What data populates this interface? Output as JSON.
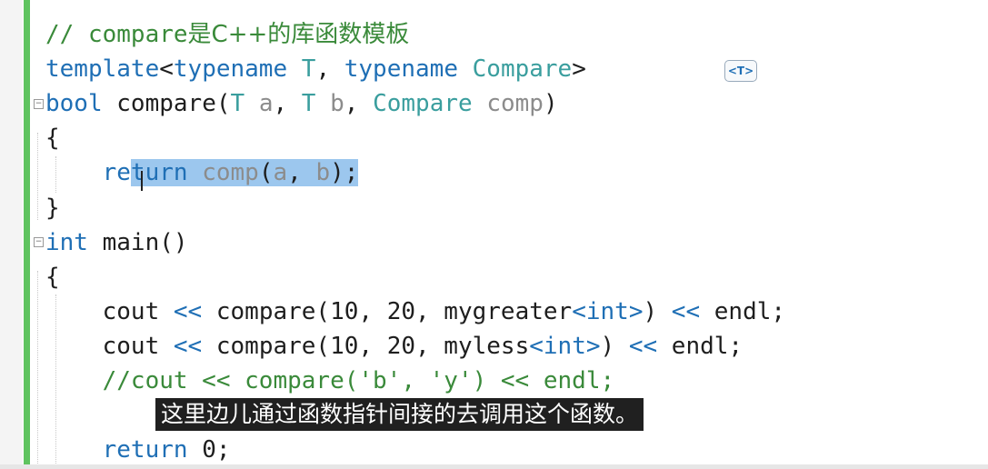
{
  "editor": {
    "lines": [
      {
        "tokens": [
          {
            "t": "// compare",
            "c": "cmt"
          },
          {
            "t": "是C++的库函数模板",
            "c": "cmt-cjk"
          }
        ]
      },
      {
        "tokens": [
          {
            "t": "template",
            "c": "kw"
          },
          {
            "t": "<",
            "c": ""
          },
          {
            "t": "typename",
            "c": "kw"
          },
          {
            "t": " ",
            "c": ""
          },
          {
            "t": "T",
            "c": "type"
          },
          {
            "t": ", ",
            "c": ""
          },
          {
            "t": "typename",
            "c": "kw"
          },
          {
            "t": " ",
            "c": ""
          },
          {
            "t": "Compare",
            "c": "type"
          },
          {
            "t": ">",
            "c": ""
          }
        ]
      },
      {
        "tokens": [
          {
            "t": "bool",
            "c": "kw"
          },
          {
            "t": " compare(",
            "c": ""
          },
          {
            "t": "T",
            "c": "type"
          },
          {
            "t": " ",
            "c": ""
          },
          {
            "t": "a",
            "c": "param"
          },
          {
            "t": ", ",
            "c": ""
          },
          {
            "t": "T",
            "c": "type"
          },
          {
            "t": " ",
            "c": ""
          },
          {
            "t": "b",
            "c": "param"
          },
          {
            "t": ", ",
            "c": ""
          },
          {
            "t": "Compare",
            "c": "type"
          },
          {
            "t": " ",
            "c": ""
          },
          {
            "t": "comp",
            "c": "param"
          },
          {
            "t": ")",
            "c": ""
          }
        ]
      },
      {
        "tokens": [
          {
            "t": "{",
            "c": ""
          }
        ]
      },
      {
        "tokens": [
          {
            "t": "    re",
            "c": "kw"
          },
          {
            "t": "turn",
            "c": "kw sel"
          },
          {
            "t": " ",
            "c": "sel"
          },
          {
            "t": "comp",
            "c": "param sel"
          },
          {
            "t": "(",
            "c": "sel"
          },
          {
            "t": "a",
            "c": "param sel"
          },
          {
            "t": ", ",
            "c": "sel"
          },
          {
            "t": "b",
            "c": "param sel"
          },
          {
            "t": ");",
            "c": "sel"
          }
        ]
      },
      {
        "tokens": [
          {
            "t": "}",
            "c": ""
          }
        ]
      },
      {
        "tokens": [
          {
            "t": "int",
            "c": "kw"
          },
          {
            "t": " main()",
            "c": ""
          }
        ]
      },
      {
        "tokens": [
          {
            "t": "{",
            "c": ""
          }
        ]
      },
      {
        "tokens": [
          {
            "t": "    cout ",
            "c": ""
          },
          {
            "t": "<<",
            "c": "kw"
          },
          {
            "t": " compare(10, 20, mygreater",
            "c": ""
          },
          {
            "t": "<",
            "c": "kw"
          },
          {
            "t": "int",
            "c": "kw"
          },
          {
            "t": ">",
            "c": "kw"
          },
          {
            "t": ") ",
            "c": ""
          },
          {
            "t": "<<",
            "c": "kw"
          },
          {
            "t": " endl;",
            "c": ""
          }
        ]
      },
      {
        "tokens": [
          {
            "t": "    cout ",
            "c": ""
          },
          {
            "t": "<<",
            "c": "kw"
          },
          {
            "t": " compare(10, 20, myless",
            "c": ""
          },
          {
            "t": "<",
            "c": "kw"
          },
          {
            "t": "int",
            "c": "kw"
          },
          {
            "t": ">",
            "c": "kw"
          },
          {
            "t": ") ",
            "c": ""
          },
          {
            "t": "<<",
            "c": "kw"
          },
          {
            "t": " endl;",
            "c": ""
          }
        ]
      },
      {
        "tokens": [
          {
            "t": "    //cout << compare('b', 'y') << endl;",
            "c": "cmt"
          }
        ]
      },
      {
        "tokens": [
          {
            "t": "",
            "c": ""
          }
        ]
      },
      {
        "tokens": [
          {
            "t": "    return",
            "c": "kw"
          },
          {
            "t": " 0;",
            "c": ""
          }
        ]
      }
    ]
  },
  "hint_badge": "<T>",
  "subtitle": "这里边儿通过函数指针间接的去调用这个函数。",
  "colors": {
    "keyword": "#1f6fb5",
    "type": "#3a9e9e",
    "comment": "#3a8a3a",
    "selection": "#9cc7ee",
    "gutter_bar": "#5fc35f"
  }
}
